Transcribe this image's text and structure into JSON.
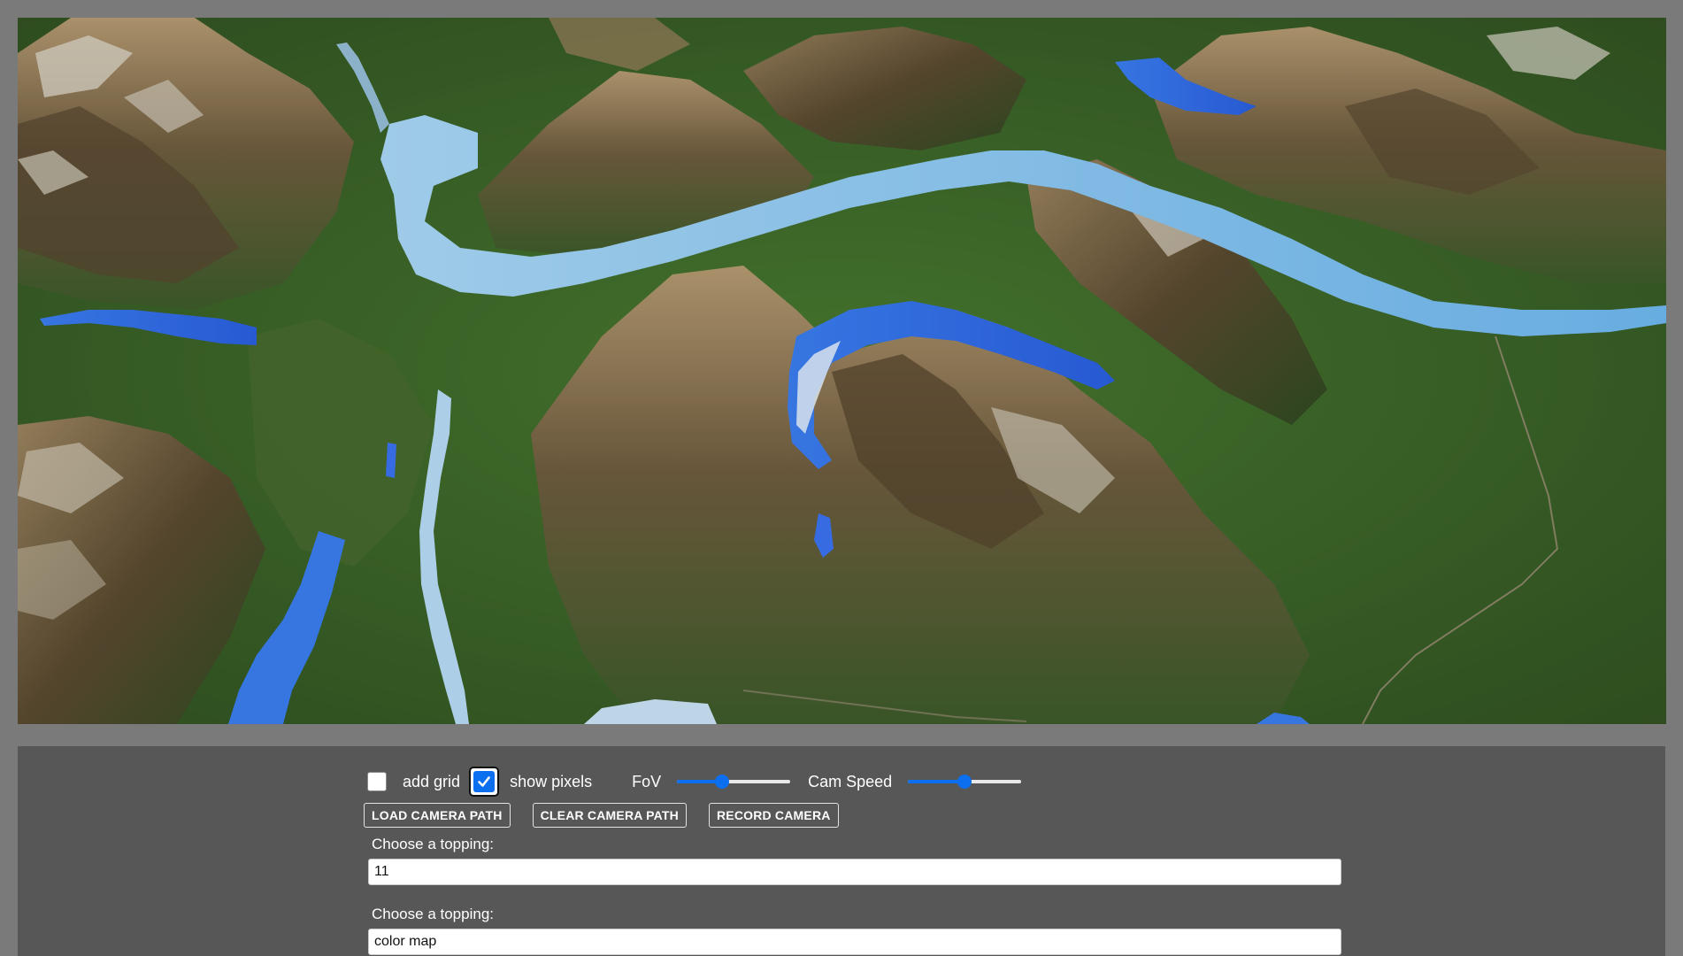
{
  "controls": {
    "add_grid": {
      "label": "add grid",
      "checked": false
    },
    "show_pixels": {
      "label": "show pixels",
      "checked": true
    },
    "fov": {
      "label": "FoV",
      "value_fraction": 0.4
    },
    "cam_speed": {
      "label": "Cam Speed",
      "value_fraction": 0.5
    },
    "buttons": {
      "load_camera_path": "LOAD CAMERA PATH",
      "clear_camera_path": "CLEAR CAMERA PATH",
      "record_camera": "RECORD CAMERA"
    },
    "toppings": [
      {
        "label": "Choose a topping:",
        "value": "11"
      },
      {
        "label": "Choose a topping:",
        "value": "color map"
      }
    ]
  },
  "colors": {
    "accent": "#0b6ff0",
    "panel": "#575757",
    "page_bg": "#7a7a7a",
    "water_light": "#7ec3f2",
    "water_dark": "#2f6ff0",
    "forest": "#3f6b2c",
    "rock": "#7a6a4c"
  },
  "icons": {
    "checkmark": "checkmark-icon"
  }
}
